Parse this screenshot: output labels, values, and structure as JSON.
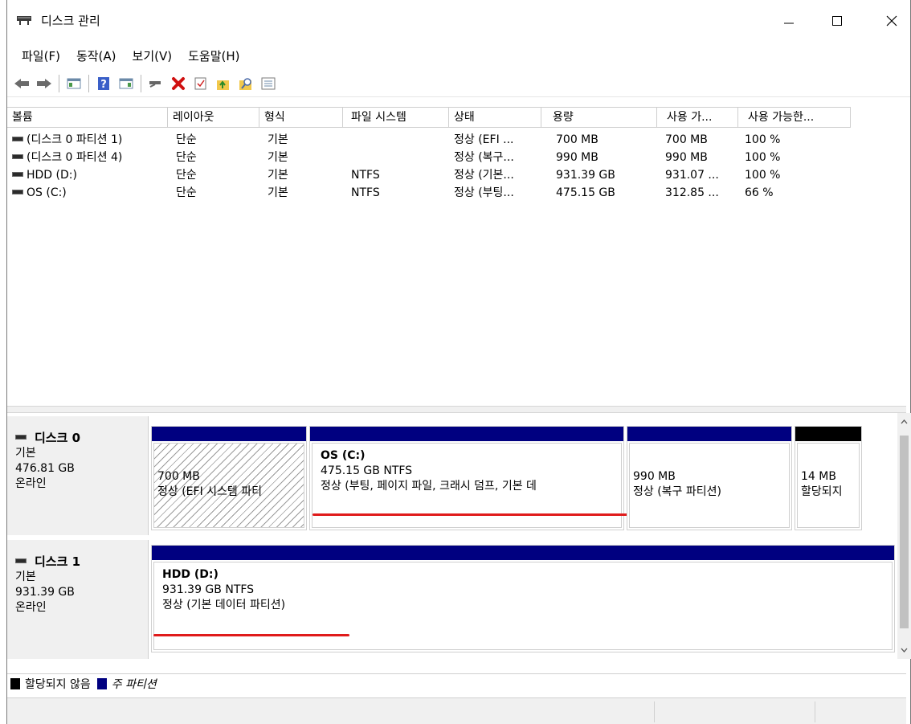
{
  "window": {
    "title": "디스크 관리"
  },
  "menu": [
    "파일(F)",
    "동작(A)",
    "보기(V)",
    "도움말(H)"
  ],
  "toolbar_icons": [
    "back-arrow-icon",
    "forward-arrow-icon",
    "console-tree-icon",
    "help-icon",
    "properties-icon",
    "connect-icon",
    "delete-icon",
    "check-icon",
    "up-arrow-icon",
    "search-icon",
    "list-icon"
  ],
  "columns": [
    "볼륨",
    "레이아웃",
    "형식",
    "파일 시스템",
    "상태",
    "용량",
    "사용 가...",
    "사용 가능한..."
  ],
  "volumes": [
    {
      "name": "(디스크 0 파티션 1)",
      "layout": "단순",
      "type": "기본",
      "fs": "",
      "status": "정상 (EFI ...",
      "capacity": "700 MB",
      "free": "700 MB",
      "pct": "100 %"
    },
    {
      "name": "(디스크 0 파티션 4)",
      "layout": "단순",
      "type": "기본",
      "fs": "",
      "status": "정상 (복구...",
      "capacity": "990 MB",
      "free": "990 MB",
      "pct": "100 %"
    },
    {
      "name": "HDD (D:)",
      "layout": "단순",
      "type": "기본",
      "fs": "NTFS",
      "status": "정상 (기본...",
      "capacity": "931.39 GB",
      "free": "931.07 ...",
      "pct": "100 %"
    },
    {
      "name": "OS (C:)",
      "layout": "단순",
      "type": "기본",
      "fs": "NTFS",
      "status": "정상 (부팅...",
      "capacity": "475.15 GB",
      "free": "312.85 ...",
      "pct": "66 %"
    }
  ],
  "disks": [
    {
      "name": "디스크 0",
      "type": "기본",
      "size": "476.81 GB",
      "state": "온라인",
      "partitions": [
        {
          "name": "",
          "size": "700 MB",
          "status": "정상 (EFI 시스템 파티"
        },
        {
          "name": "OS  (C:)",
          "size": "475.15 GB NTFS",
          "status": "정상 (부팅, 페이지 파일, 크래시 덤프, 기본 데"
        },
        {
          "name": "",
          "size": "990 MB",
          "status": "정상 (복구 파티션)"
        },
        {
          "name": "",
          "size": "14 MB",
          "status": "할당되지"
        }
      ]
    },
    {
      "name": "디스크 1",
      "type": "기본",
      "size": "931.39 GB",
      "state": "온라인",
      "partitions": [
        {
          "name": "HDD  (D:)",
          "size": "931.39 GB NTFS",
          "status": "정상 (기본 데이터 파티션)"
        }
      ]
    }
  ],
  "legend": {
    "unallocated": "할당되지 않음",
    "primary": "주 파티션"
  },
  "colors": {
    "primary_bar": "#000080",
    "unallocated_bar": "#000000",
    "annotation": "#e01b1b"
  }
}
